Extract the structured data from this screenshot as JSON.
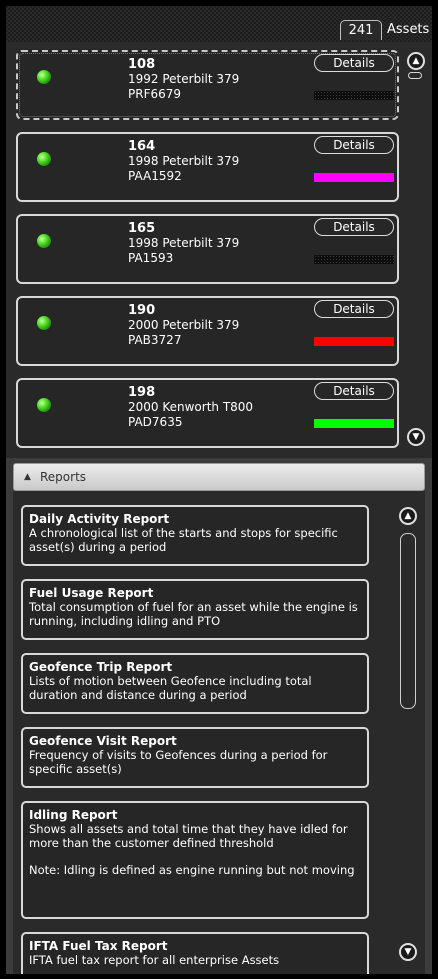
{
  "header": {
    "asset_count": "241",
    "assets_label": "Assets"
  },
  "assets": [
    {
      "id": "108",
      "model": "1992 Peterbilt 379",
      "plate": "PRF6679",
      "status_color": "#3fd91f",
      "bar_color": "#0d0d0d",
      "details_label": "Details"
    },
    {
      "id": "164",
      "model": "1998 Peterbilt 379",
      "plate": "PAA1592",
      "status_color": "#3fd91f",
      "bar_color": "#ff00ff",
      "details_label": "Details"
    },
    {
      "id": "165",
      "model": "1998 Peterbilt 379",
      "plate": "PA1593",
      "status_color": "#3fd91f",
      "bar_color": "#0d0d0d",
      "details_label": "Details"
    },
    {
      "id": "190",
      "model": "2000 Peterbilt 379",
      "plate": "PAB3727",
      "status_color": "#3fd91f",
      "bar_color": "#ff0000",
      "details_label": "Details"
    },
    {
      "id": "198",
      "model": "2000 Kenworth T800",
      "plate": "PAD7635",
      "status_color": "#3fd91f",
      "bar_color": "#00ff00",
      "details_label": "Details"
    }
  ],
  "reports": {
    "header_label": "Reports",
    "items": [
      {
        "title": "Daily Activity Report",
        "description": "A chronological list of the starts and stops for specific asset(s) during a period"
      },
      {
        "title": "Fuel Usage Report",
        "description": "Total consumption of fuel for an asset while the engine is running, including idling and PTO"
      },
      {
        "title": "Geofence Trip Report",
        "description": "Lists of motion between Geofence including total duration and distance during a period"
      },
      {
        "title": "Geofence Visit Report",
        "description": "Frequency of visits to Geofences during a period for specific asset(s)"
      },
      {
        "title": "Idling Report",
        "description": "Shows all assets and total time that they have idled for more than the customer defined threshold",
        "note": "Note: Idling is defined as engine running but not moving"
      },
      {
        "title": "IFTA Fuel Tax Report",
        "description": "IFTA fuel tax report for all enterprise Assets"
      }
    ]
  },
  "icons": {
    "scroll_up": "chevron-up-icon",
    "scroll_down": "chevron-down-icon",
    "collapse": "triangle-up-icon"
  }
}
